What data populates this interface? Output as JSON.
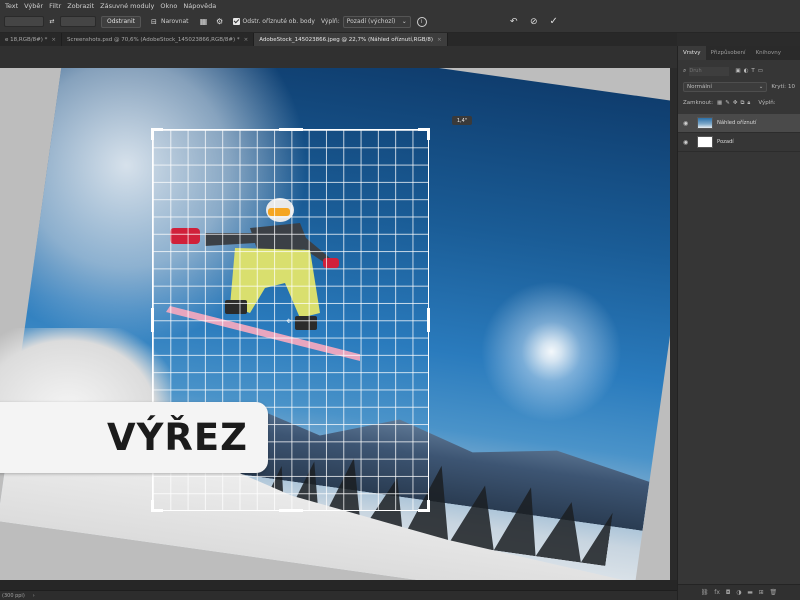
{
  "menu": {
    "items": [
      "Text",
      "Výběr",
      "Filtr",
      "Zobrazit",
      "Zásuvné moduly",
      "Okno",
      "Nápověda"
    ]
  },
  "options_bar": {
    "clear_label": "Odstranit",
    "straighten_label": "Narovnat",
    "delete_cropped_label": "Odstr. oříznuté ob. body",
    "fill_label": "Výplň:",
    "fill_value": "Pozadí (výchozí)"
  },
  "tabs": [
    {
      "label": "e 18,RGB/8#) *"
    },
    {
      "label": "Screenshots.psd @ 70,6% (AdobeStock_145023866,RGB/8#) *"
    },
    {
      "label": "AdobeStock_145023866.jpeg @ 22,7% (Náhled oříznutí,RGB/8)"
    }
  ],
  "canvas": {
    "size_badge": "1,4\"",
    "overlay_title": "VÝŘEZ"
  },
  "layers_panel": {
    "tabs": [
      "Vrstvy",
      "Přizpůsobení",
      "Knihovny"
    ],
    "search_placeholder": "Druh",
    "blend_mode": "Normální",
    "opacity_label": "Krytí:",
    "opacity_value": "10",
    "lock_label": "Zamknout:",
    "fill_label": "Výplň:",
    "layers": [
      {
        "name": "Náhled oříznutí",
        "selected": true
      },
      {
        "name": "Pozadí",
        "selected": false
      }
    ]
  },
  "status": {
    "zoom": "(300 ppi)"
  }
}
